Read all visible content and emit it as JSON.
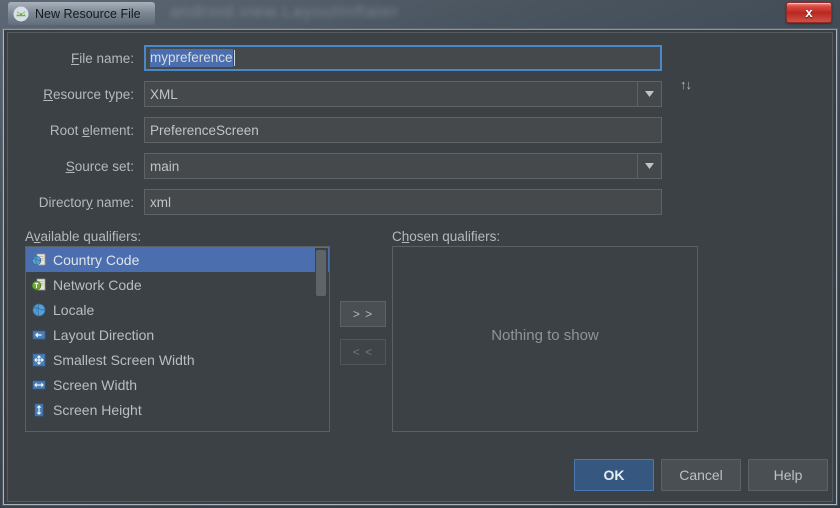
{
  "window": {
    "title": "New Resource File",
    "title_icon": "android-studio-icon",
    "close_label": "x",
    "desktop_background_text": "android.view.LayoutInflater"
  },
  "form": {
    "rows": [
      {
        "label_before": "F",
        "label_mnemonic": "F",
        "label": "File name:",
        "label_pre": "",
        "label_mn": "F",
        "label_post": "ile name:",
        "value": "mypreference",
        "type": "text",
        "focused": true
      },
      {
        "label_pre": "",
        "label_mn": "R",
        "label_post": "esource type:",
        "value": "XML",
        "type": "combo",
        "focused": false
      },
      {
        "label_pre": "Root ",
        "label_mn": "e",
        "label_post": "lement:",
        "value": "PreferenceScreen",
        "type": "text",
        "focused": false
      },
      {
        "label_pre": "",
        "label_mn": "S",
        "label_post": "ource set:",
        "value": "main",
        "type": "combo",
        "focused": false
      },
      {
        "label_pre": "Director",
        "label_mn": "y",
        "label_post": " name:",
        "value": "xml",
        "type": "text",
        "focused": false
      }
    ],
    "sort_icon": "↑↓"
  },
  "qualifiers": {
    "available_label_pre": "A",
    "available_label_mn": "v",
    "available_label_post": "ailable qualifiers:",
    "chosen_label_pre": "C",
    "chosen_label_mn": "h",
    "chosen_label_post": "osen qualifiers:",
    "available": [
      {
        "label": "Country Code",
        "icon": "globe-page-icon",
        "selected": true
      },
      {
        "label": "Network Code",
        "icon": "network-page-icon",
        "selected": false
      },
      {
        "label": "Locale",
        "icon": "globe-icon",
        "selected": false
      },
      {
        "label": "Layout Direction",
        "icon": "layout-direction-icon",
        "selected": false
      },
      {
        "label": "Smallest Screen Width",
        "icon": "smallest-width-icon",
        "selected": false
      },
      {
        "label": "Screen Width",
        "icon": "screen-width-icon",
        "selected": false
      },
      {
        "label": "Screen Height",
        "icon": "screen-height-icon",
        "selected": false
      }
    ],
    "empty_text": "Nothing to show",
    "add_label": "> >",
    "remove_label": "< <"
  },
  "footer": {
    "ok_label": "OK",
    "cancel_label": "Cancel",
    "help_label": "Help"
  },
  "colors": {
    "accent_selection": "#4b6eaf",
    "default_button": "#365880",
    "panel": "#3c4146",
    "close_button": "#b92820"
  }
}
